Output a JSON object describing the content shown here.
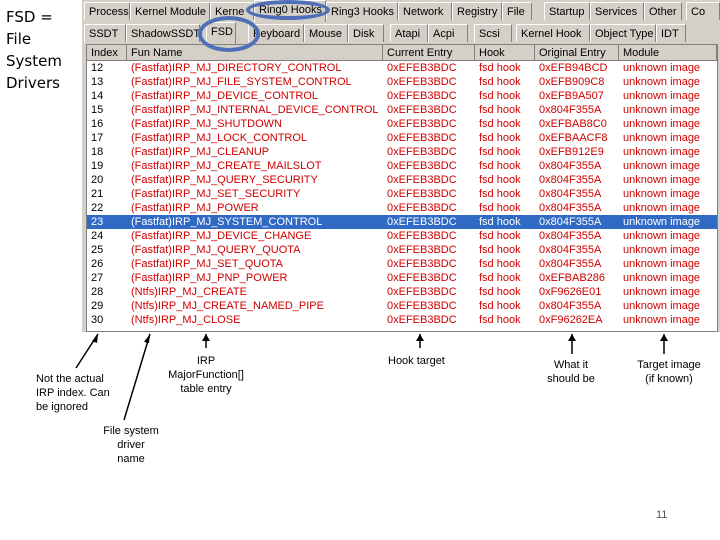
{
  "side_title": "FSD =\nFile\nSystem\nDrivers",
  "tabs_row1": [
    "Process",
    "Kernel Module",
    "Kerne",
    "Ring0 Hooks",
    "Ring3 Hooks",
    "Network",
    "Registry",
    "File",
    "Startup",
    "Services",
    "Other",
    "Co"
  ],
  "tabs_row2": [
    "SSDT",
    "ShadowSSDT",
    "FSD",
    "Keyboard",
    "Mouse",
    "Disk",
    "Atapi",
    "Acpi",
    "Scsi",
    "Kernel Hook",
    "Object Type",
    "IDT"
  ],
  "columns": [
    "Index",
    "Fun Name",
    "Current Entry",
    "Hook",
    "Original Entry",
    "Module"
  ],
  "rows": [
    {
      "index": "12",
      "fun": "(Fastfat)IRP_MJ_DIRECTORY_CONTROL",
      "current": "0xEFEB3BDC",
      "hook": "fsd hook",
      "original": "0xEFB94BCD",
      "module": "unknown image"
    },
    {
      "index": "13",
      "fun": "(Fastfat)IRP_MJ_FILE_SYSTEM_CONTROL",
      "current": "0xEFEB3BDC",
      "hook": "fsd hook",
      "original": "0xEFB909C8",
      "module": "unknown image"
    },
    {
      "index": "14",
      "fun": "(Fastfat)IRP_MJ_DEVICE_CONTROL",
      "current": "0xEFEB3BDC",
      "hook": "fsd hook",
      "original": "0xEFB9A507",
      "module": "unknown image"
    },
    {
      "index": "15",
      "fun": "(Fastfat)IRP_MJ_INTERNAL_DEVICE_CONTROL",
      "current": "0xEFEB3BDC",
      "hook": "fsd hook",
      "original": "0x804F355A",
      "module": "unknown image"
    },
    {
      "index": "16",
      "fun": "(Fastfat)IRP_MJ_SHUTDOWN",
      "current": "0xEFEB3BDC",
      "hook": "fsd hook",
      "original": "0xEFBAB8C0",
      "module": "unknown image"
    },
    {
      "index": "17",
      "fun": "(Fastfat)IRP_MJ_LOCK_CONTROL",
      "current": "0xEFEB3BDC",
      "hook": "fsd hook",
      "original": "0xEFBAACF8",
      "module": "unknown image"
    },
    {
      "index": "18",
      "fun": "(Fastfat)IRP_MJ_CLEANUP",
      "current": "0xEFEB3BDC",
      "hook": "fsd hook",
      "original": "0xEFB912E9",
      "module": "unknown image"
    },
    {
      "index": "19",
      "fun": "(Fastfat)IRP_MJ_CREATE_MAILSLOT",
      "current": "0xEFEB3BDC",
      "hook": "fsd hook",
      "original": "0x804F355A",
      "module": "unknown image"
    },
    {
      "index": "20",
      "fun": "(Fastfat)IRP_MJ_QUERY_SECURITY",
      "current": "0xEFEB3BDC",
      "hook": "fsd hook",
      "original": "0x804F355A",
      "module": "unknown image"
    },
    {
      "index": "21",
      "fun": "(Fastfat)IRP_MJ_SET_SECURITY",
      "current": "0xEFEB3BDC",
      "hook": "fsd hook",
      "original": "0x804F355A",
      "module": "unknown image"
    },
    {
      "index": "22",
      "fun": "(Fastfat)IRP_MJ_POWER",
      "current": "0xEFEB3BDC",
      "hook": "fsd hook",
      "original": "0x804F355A",
      "module": "unknown image"
    },
    {
      "index": "23",
      "fun": "(Fastfat)IRP_MJ_SYSTEM_CONTROL",
      "current": "0xEFEB3BDC",
      "hook": "fsd hook",
      "original": "0x804F355A",
      "module": "unknown image",
      "selected": true
    },
    {
      "index": "24",
      "fun": "(Fastfat)IRP_MJ_DEVICE_CHANGE",
      "current": "0xEFEB3BDC",
      "hook": "fsd hook",
      "original": "0x804F355A",
      "module": "unknown image"
    },
    {
      "index": "25",
      "fun": "(Fastfat)IRP_MJ_QUERY_QUOTA",
      "current": "0xEFEB3BDC",
      "hook": "fsd hook",
      "original": "0x804F355A",
      "module": "unknown image"
    },
    {
      "index": "26",
      "fun": "(Fastfat)IRP_MJ_SET_QUOTA",
      "current": "0xEFEB3BDC",
      "hook": "fsd hook",
      "original": "0x804F355A",
      "module": "unknown image"
    },
    {
      "index": "27",
      "fun": "(Fastfat)IRP_MJ_PNP_POWER",
      "current": "0xEFEB3BDC",
      "hook": "fsd hook",
      "original": "0xEFBAB286",
      "module": "unknown image"
    },
    {
      "index": "28",
      "fun": "(Ntfs)IRP_MJ_CREATE",
      "current": "0xEFEB3BDC",
      "hook": "fsd hook",
      "original": "0xF9626E01",
      "module": "unknown image"
    },
    {
      "index": "29",
      "fun": "(Ntfs)IRP_MJ_CREATE_NAMED_PIPE",
      "current": "0xEFEB3BDC",
      "hook": "fsd hook",
      "original": "0x804F355A",
      "module": "unknown image"
    },
    {
      "index": "30",
      "fun": "(Ntfs)IRP_MJ_CLOSE",
      "current": "0xEFEB3BDC",
      "hook": "fsd hook",
      "original": "0xF96262EA",
      "module": "unknown image"
    }
  ],
  "annotations": {
    "index_note": "Not the actual\nIRP index. Can\nbe ignored",
    "fsd_note": "File system\ndriver\nname",
    "irp_note": "IRP\nMajorFunction[]\ntable entry",
    "hook_note": "Hook target",
    "original_note": "What it\nshould be",
    "module_note": "Target image\n(if known)"
  },
  "page_number": "11",
  "colors": {
    "entry_red": "#d00000",
    "selection": "#316ac5",
    "circle": "#4f6fb8"
  }
}
